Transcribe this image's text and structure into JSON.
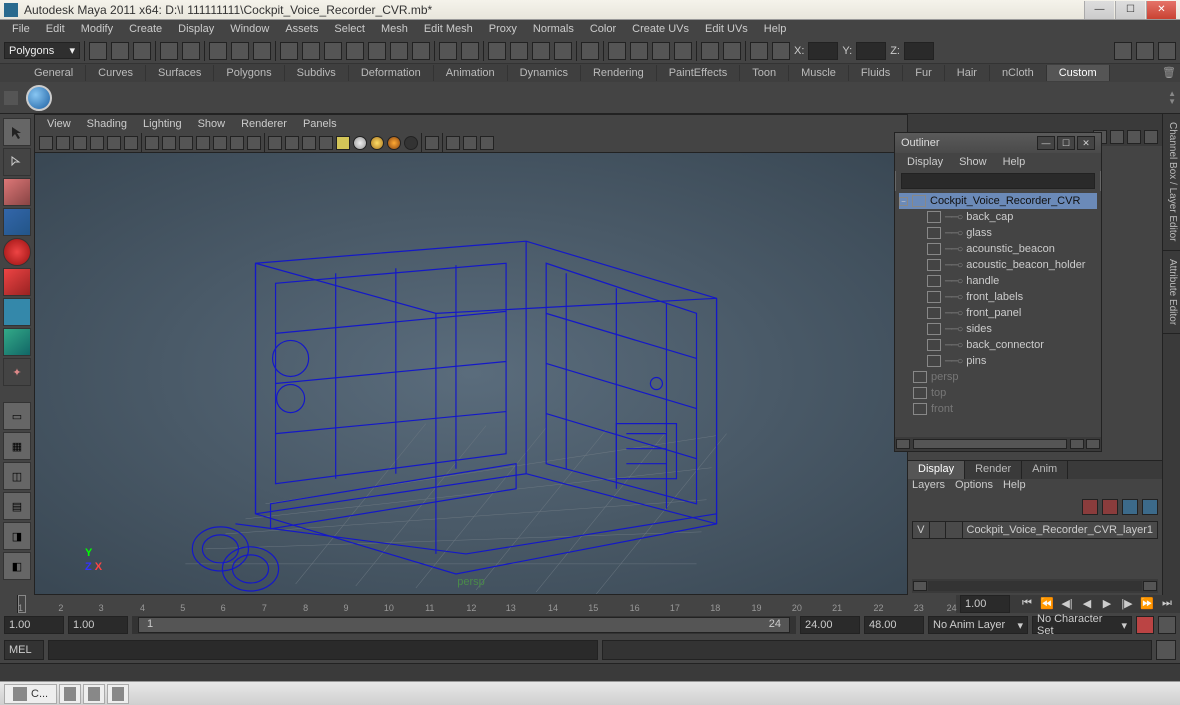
{
  "titlebar": {
    "title": "Autodesk Maya 2011 x64: D:\\I 111111111\\Cockpit_Voice_Recorder_CVR.mb*"
  },
  "menubar": [
    "File",
    "Edit",
    "Modify",
    "Create",
    "Display",
    "Window",
    "Assets",
    "Select",
    "Mesh",
    "Edit Mesh",
    "Proxy",
    "Normals",
    "Color",
    "Create UVs",
    "Edit UVs",
    "Help"
  ],
  "modeSelector": {
    "label": "Polygons"
  },
  "statusCoords": {
    "x": "X:",
    "y": "Y:",
    "z": "Z:"
  },
  "shelfTabs": [
    "General",
    "Curves",
    "Surfaces",
    "Polygons",
    "Subdivs",
    "Deformation",
    "Animation",
    "Dynamics",
    "Rendering",
    "PaintEffects",
    "Toon",
    "Muscle",
    "Fluids",
    "Fur",
    "Hair",
    "nCloth",
    "Custom"
  ],
  "shelfActive": "Custom",
  "viewportMenu": [
    "View",
    "Shading",
    "Lighting",
    "Show",
    "Renderer",
    "Panels"
  ],
  "viewportCamera": "persp",
  "outliner": {
    "title": "Outliner",
    "menu": [
      "Display",
      "Show",
      "Help"
    ],
    "root": "Cockpit_Voice_Recorder_CVR",
    "children": [
      "back_cap",
      "glass",
      "acounstic_beacon",
      "acoustic_beacon_holder",
      "handle",
      "front_labels",
      "front_panel",
      "sides",
      "back_connector",
      "pins"
    ],
    "dimmed": [
      "persp",
      "top",
      "front"
    ]
  },
  "rightTabs": {
    "cb": "Channel Box / Layer Editor",
    "ae": "Attribute Editor"
  },
  "layerPanel": {
    "tabs": [
      "Display",
      "Render",
      "Anim"
    ],
    "active": "Display",
    "menu": [
      "Layers",
      "Options",
      "Help"
    ],
    "row": {
      "vis": "V",
      "name": "Cockpit_Voice_Recorder_CVR_layer1"
    }
  },
  "timeSlider": {
    "ticks": [
      "1",
      "2",
      "3",
      "4",
      "5",
      "6",
      "7",
      "8",
      "9",
      "10",
      "11",
      "12",
      "13",
      "14",
      "15",
      "16",
      "17",
      "18",
      "19",
      "20",
      "21",
      "22",
      "23",
      "24"
    ],
    "current": "1.00"
  },
  "rangeSlider": {
    "startOuter": "1.00",
    "startInner": "1.00",
    "rangeStart": "1",
    "rangeEnd": "24",
    "endInner": "24.00",
    "endOuter": "48.00",
    "animLayer": "No Anim Layer",
    "charSet": "No Character Set"
  },
  "cmd": {
    "lang": "MEL"
  },
  "taskbar": {
    "item": "C..."
  }
}
